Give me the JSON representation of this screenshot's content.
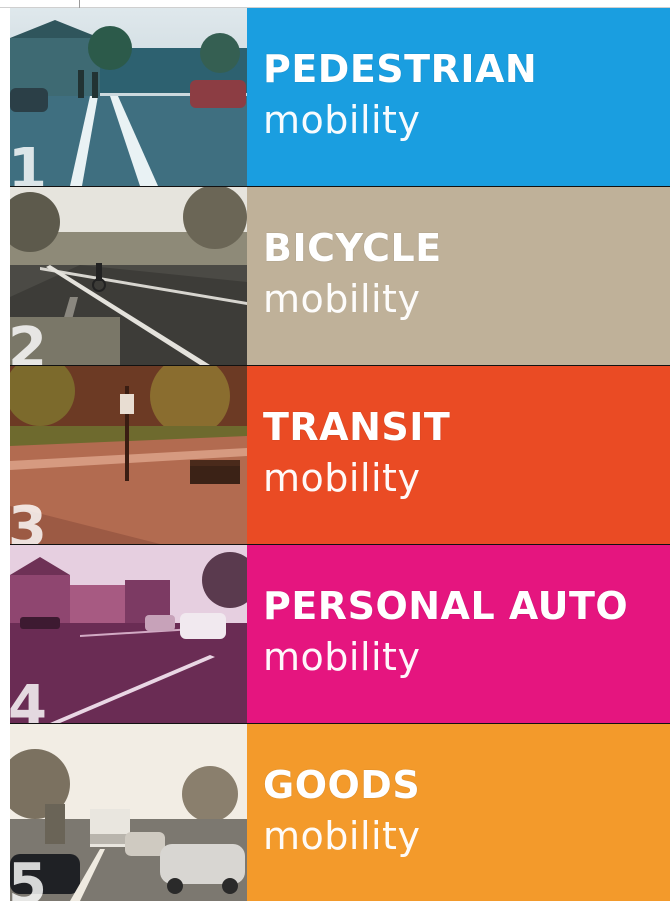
{
  "panels": [
    {
      "number": "1",
      "title": "PEDESTRIAN",
      "subtitle": "mobility",
      "color": "#1a9ee0",
      "photo_icon": "street-crosswalk-photo"
    },
    {
      "number": "2",
      "title": "BICYCLE",
      "subtitle": "mobility",
      "color": "#bfb199",
      "photo_icon": "bike-lane-photo"
    },
    {
      "number": "3",
      "title": "TRANSIT",
      "subtitle": "mobility",
      "color": "#ea4b24",
      "photo_icon": "bus-stop-photo"
    },
    {
      "number": "4",
      "title": "PERSONAL AUTO",
      "subtitle": "mobility",
      "color": "#e5157f",
      "photo_icon": "main-street-photo"
    },
    {
      "number": "5",
      "title": "GOODS",
      "subtitle": "mobility",
      "color": "#f39a2b",
      "photo_icon": "delivery-truck-photo"
    }
  ]
}
